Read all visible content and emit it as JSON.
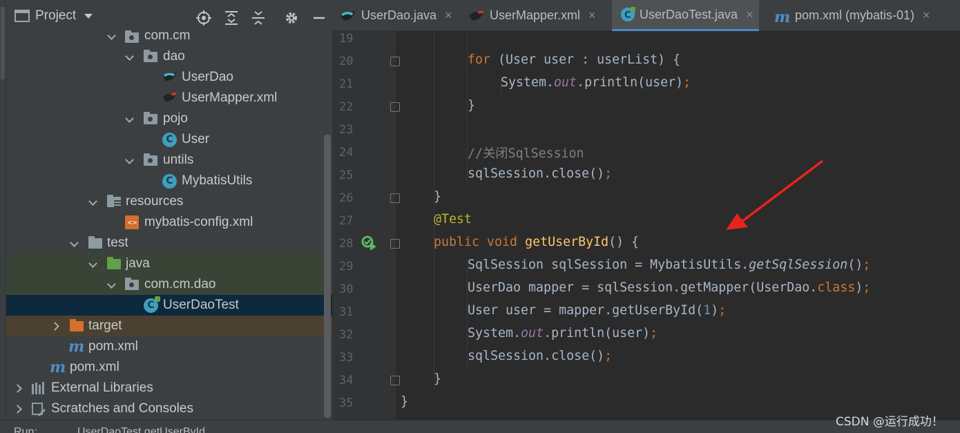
{
  "project_panel": {
    "title": "Project",
    "tree": [
      {
        "label": "com.cm"
      },
      {
        "label": "dao"
      },
      {
        "label": "UserDao"
      },
      {
        "label": "UserMapper.xml"
      },
      {
        "label": "pojo"
      },
      {
        "label": "User"
      },
      {
        "label": "untils"
      },
      {
        "label": "MybatisUtils"
      },
      {
        "label": "resources"
      },
      {
        "label": "mybatis-config.xml"
      },
      {
        "label": "test"
      },
      {
        "label": "java"
      },
      {
        "label": "com.cm.dao"
      },
      {
        "label": "UserDaoTest"
      },
      {
        "label": "target"
      },
      {
        "label": "pom.xml"
      },
      {
        "label": "pom.xml"
      },
      {
        "label": "External Libraries"
      },
      {
        "label": "Scratches and Consoles"
      }
    ]
  },
  "editor_tabs": [
    {
      "label": "UserDao.java",
      "close": "×"
    },
    {
      "label": "UserMapper.xml",
      "close": "×"
    },
    {
      "label": "UserDaoTest.java",
      "close": "×"
    },
    {
      "label": "pom.xml (mybatis-01)",
      "close": "×"
    }
  ],
  "editor": {
    "line_numbers": [
      "19",
      "20",
      "21",
      "22",
      "23",
      "24",
      "25",
      "26",
      "27",
      "28",
      "29",
      "30",
      "31",
      "32",
      "33",
      "34",
      "35"
    ]
  },
  "bottom_bar": {
    "run_label": "Run:",
    "run_config": "UserDaoTest.getUserById"
  },
  "watermark": "CSDN @运行成功！",
  "colors": {
    "annotation_arrow": "#e8231d",
    "selection": "#0d293e",
    "keyword": "#cc7832",
    "method": "#ffc66d"
  }
}
